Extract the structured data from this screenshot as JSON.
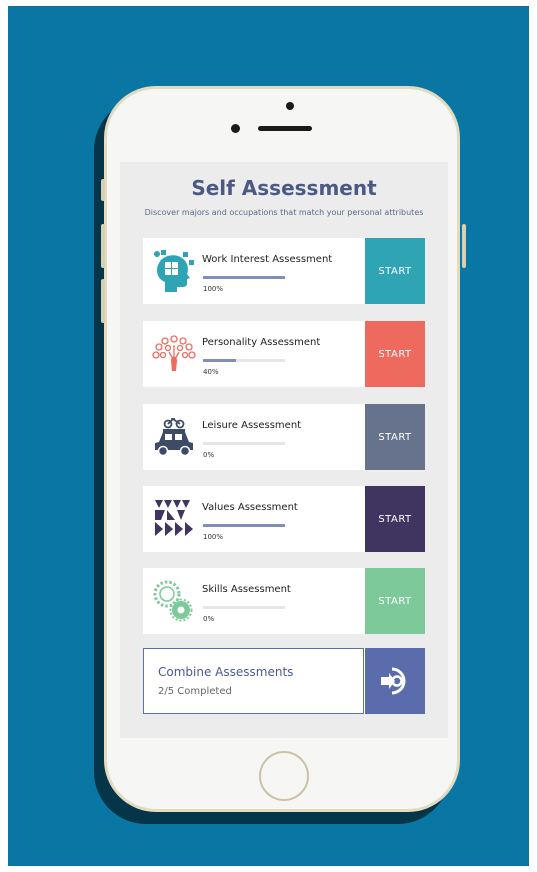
{
  "header": {
    "title": "Self Assessment",
    "subtitle": "Discover majors and occupations that match your personal attributes"
  },
  "assessments": [
    {
      "name": "Work Interest Assessment",
      "progress_label": "100%",
      "progress": 1.0,
      "start_label": "START",
      "color": "#2fa4b5",
      "icon": "head-puzzle-icon"
    },
    {
      "name": "Personality Assessment",
      "progress_label": "40%",
      "progress": 0.4,
      "start_label": "START",
      "color": "#ee6a5f",
      "icon": "peacock-icon"
    },
    {
      "name": "Leisure Assessment",
      "progress_label": "0%",
      "progress": 0.0,
      "start_label": "START",
      "color": "#67738c",
      "icon": "car-bike-icon"
    },
    {
      "name": "Values Assessment",
      "progress_label": "100%",
      "progress": 1.0,
      "start_label": "START",
      "color": "#3f3560",
      "icon": "arrows-pattern-icon"
    },
    {
      "name": "Skills Assessment",
      "progress_label": "0%",
      "progress": 0.0,
      "start_label": "START",
      "color": "#7dc99a",
      "icon": "gears-icon"
    }
  ],
  "combine": {
    "title": "Combine Assessments",
    "status": "2/5 Completed",
    "icon": "combine-arrow-icon",
    "color": "#5a6cab"
  },
  "colors": {
    "background": "#0a76a3",
    "title": "#4a5a85",
    "progress_fill": "#7f8fb8"
  }
}
